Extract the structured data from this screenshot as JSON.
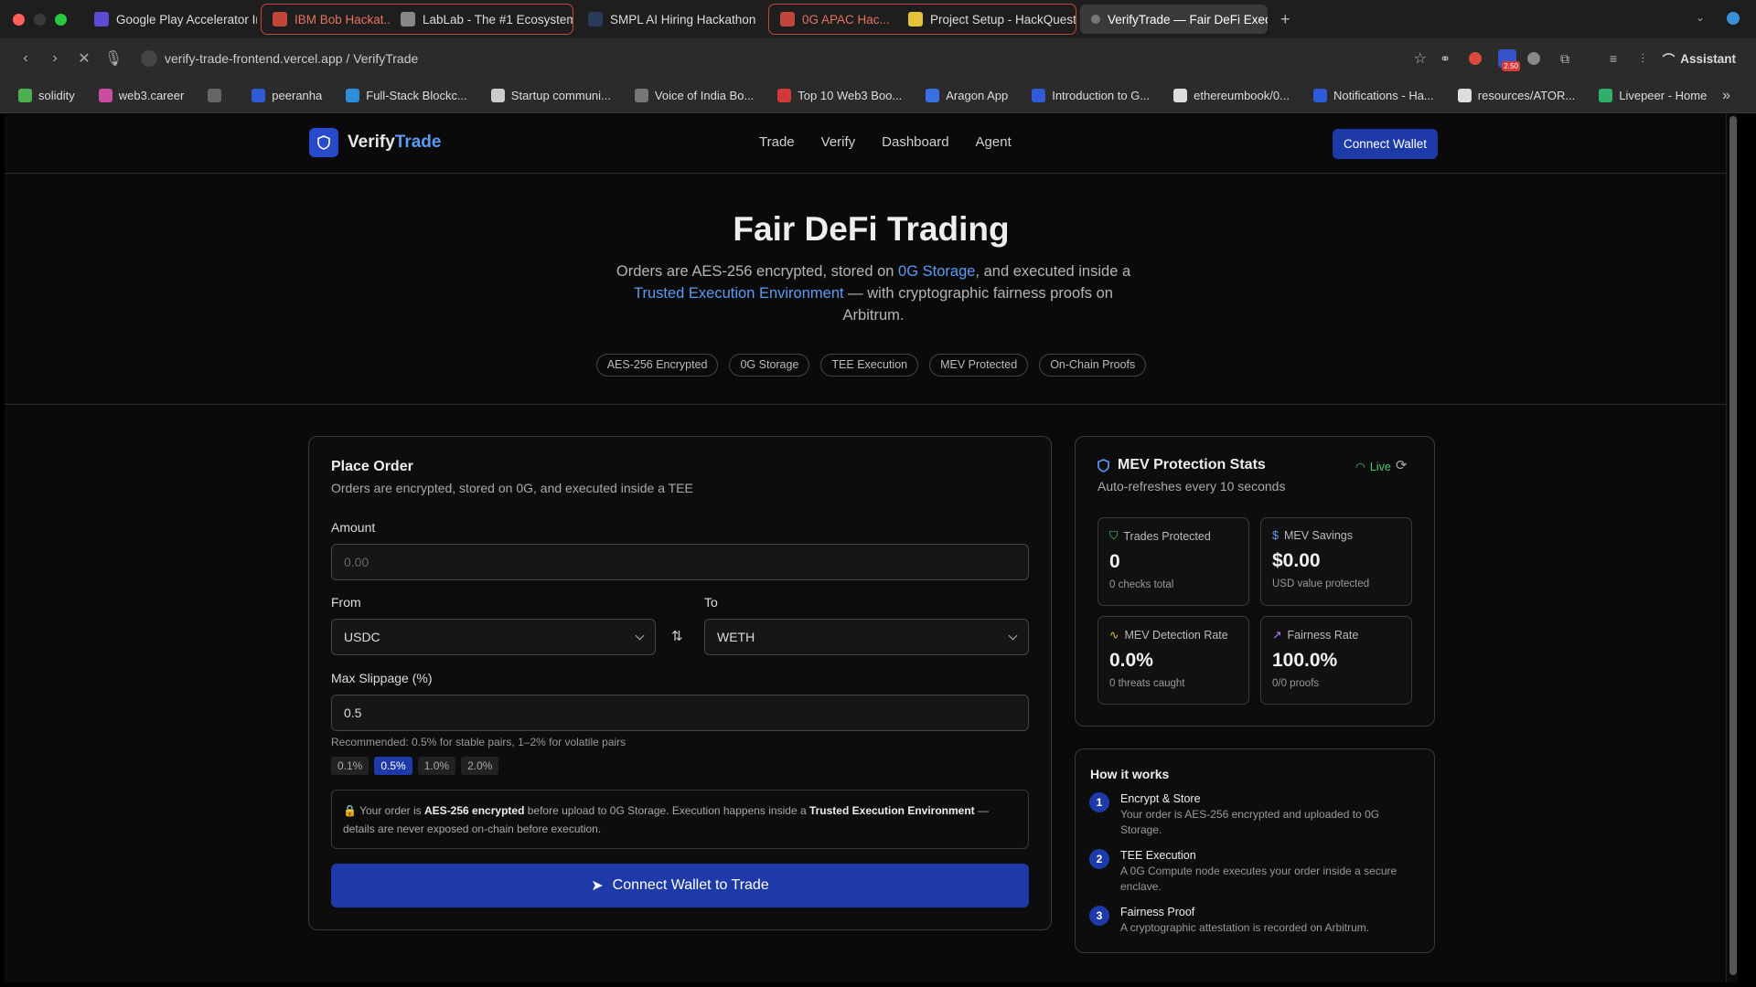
{
  "browser": {
    "tabs": [
      {
        "title": "Google Play Accelerator Indi",
        "color": "#5b4bd3"
      },
      {
        "title": "IBM Bob Hackat...",
        "color": "#c2453a",
        "group": "red"
      },
      {
        "title": "LabLab - The #1 Ecosystem",
        "color": "#888",
        "group": "red"
      },
      {
        "title": "SMPL AI Hiring Hackathon",
        "color": "#2a3a5a"
      },
      {
        "title": "0G APAC Hac...",
        "color": "#c2453a",
        "group": "red2"
      },
      {
        "title": "Project Setup - HackQuest",
        "color": "#e4c23a",
        "group": "red2"
      },
      {
        "title": "VerifyTrade — Fair DeFi Exec",
        "color": "#777",
        "active": true
      }
    ],
    "new_tab": "+",
    "url": "verify-trade-frontend.vercel.app / VerifyTrade",
    "assistant": "Assistant",
    "badge": "2.50",
    "bookmarks": [
      {
        "label": "solidity",
        "color": "#4caf50"
      },
      {
        "label": "web3.career",
        "color": "#c94ca0"
      },
      {
        "label": "",
        "color": "#666"
      },
      {
        "label": "peeranha",
        "color": "#2f5bd8"
      },
      {
        "label": "Full-Stack Blockc...",
        "color": "#2d8fd8"
      },
      {
        "label": "Startup communi...",
        "color": "#ccc"
      },
      {
        "label": "Voice of India Bo...",
        "color": "#777"
      },
      {
        "label": "Top 10 Web3 Boo...",
        "color": "#d23a3a"
      },
      {
        "label": "Aragon App",
        "color": "#3a6fe4"
      },
      {
        "label": "Introduction to G...",
        "color": "#2f5bd8"
      },
      {
        "label": "ethereumbook/0...",
        "color": "#ddd"
      },
      {
        "label": "Notifications - Ha...",
        "color": "#2f5bd8"
      },
      {
        "label": "resources/ATOR...",
        "color": "#ddd"
      },
      {
        "label": "Livepeer - Home",
        "color": "#2fb06a"
      }
    ],
    "more_bookmarks": "»"
  },
  "site": {
    "logo_a": "Verify",
    "logo_b": "Trade",
    "nav": [
      "Trade",
      "Verify",
      "Dashboard",
      "Agent"
    ],
    "connect_wallet": "Connect Wallet",
    "accent": "#1d3aa8"
  },
  "hero": {
    "title": "Fair DeFi Trading",
    "sub1": "Orders are AES-256 encrypted, stored on ",
    "sub_link1": "0G Storage",
    "sub2": ", and executed inside a ",
    "sub_link2": "Trusted Execution Environment",
    "sub3": " — with cryptographic fairness proofs on Arbitrum.",
    "pills": [
      "AES-256 Encrypted",
      "0G Storage",
      "TEE Execution",
      "MEV Protected",
      "On-Chain Proofs"
    ]
  },
  "order": {
    "title": "Place Order",
    "subtitle": "Orders are encrypted, stored on 0G, and executed inside a TEE",
    "amount_label": "Amount",
    "amount_placeholder": "0.00",
    "from_label": "From",
    "from_value": "USDC",
    "to_label": "To",
    "to_value": "WETH",
    "slippage_label": "Max Slippage (%)",
    "slippage_value": "0.5",
    "slippage_hint": "Recommended: 0.5% for stable pairs, 1–2% for volatile pairs",
    "presets": [
      "0.1%",
      "0.5%",
      "1.0%",
      "2.0%"
    ],
    "selected_preset": "0.5%",
    "notice_1": "Your order is ",
    "notice_b1": "AES-256 encrypted",
    "notice_2": " before upload to 0G Storage. Execution happens inside a ",
    "notice_b2": "Trusted Execution Environment",
    "notice_3": " — details are never exposed on-chain before execution.",
    "submit": "Connect Wallet to Trade"
  },
  "mev": {
    "title": "MEV Protection Stats",
    "live": "Live",
    "subtitle": "Auto-refreshes every 10 seconds",
    "stats": [
      {
        "title": "Trades Protected",
        "value": "0",
        "sub": "0 checks total",
        "icon": "shield-icon",
        "color": "#3fcf6a"
      },
      {
        "title": "MEV Savings",
        "value": "$0.00",
        "sub": "USD value protected",
        "icon": "dollar-icon",
        "color": "#5a9cf5"
      },
      {
        "title": "MEV Detection Rate",
        "value": "0.0%",
        "sub": "0 threats caught",
        "icon": "activity-icon",
        "color": "#e8c23a"
      },
      {
        "title": "Fairness Rate",
        "value": "100.0%",
        "sub": "0/0 proofs",
        "icon": "trending-up-icon",
        "color": "#b77ef5"
      }
    ]
  },
  "how": {
    "title": "How it works",
    "steps": [
      {
        "n": "1",
        "title": "Encrypt & Store",
        "desc": "Your order is AES-256 encrypted and uploaded to 0G Storage."
      },
      {
        "n": "2",
        "title": "TEE Execution",
        "desc": "A 0G Compute node executes your order inside a secure enclave."
      },
      {
        "n": "3",
        "title": "Fairness Proof",
        "desc": "A cryptographic attestation is recorded on Arbitrum."
      }
    ]
  }
}
